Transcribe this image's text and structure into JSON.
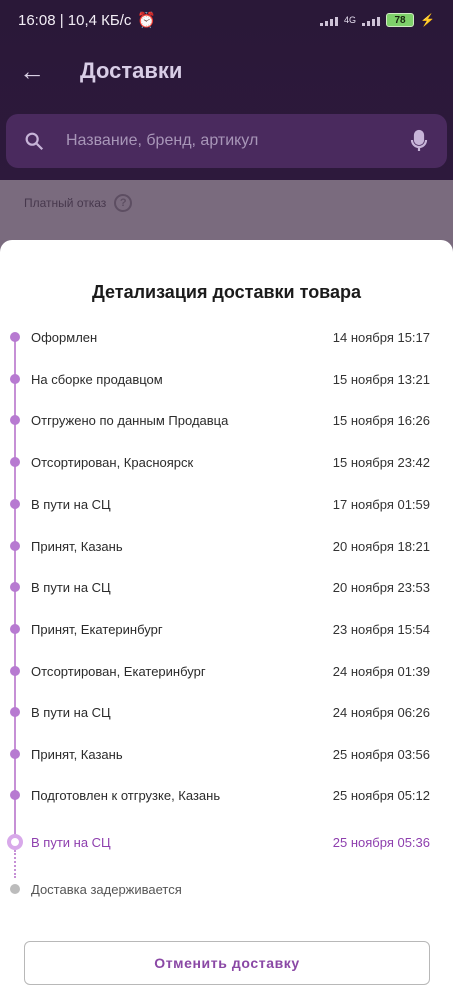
{
  "status_bar": {
    "time_info": "16:08 | 10,4 КБ/с",
    "network": "4G",
    "battery": "78"
  },
  "toolbar": {
    "title": "Доставки"
  },
  "search": {
    "placeholder": "Название, бренд, артикул"
  },
  "under_card": {
    "label": "Платный отказ"
  },
  "sheet": {
    "title": "Детализация доставки товара",
    "events": [
      {
        "label": "Оформлен",
        "time": "14 ноября 15:17"
      },
      {
        "label": "На сборке продавцом",
        "time": "15 ноября 13:21"
      },
      {
        "label": "Отгружено по данным Продавца",
        "time": "15 ноября 16:26"
      },
      {
        "label": "Отсортирован, Красноярск",
        "time": "15 ноября 23:42"
      },
      {
        "label": "В пути на СЦ",
        "time": "17 ноября 01:59"
      },
      {
        "label": "Принят, Казань",
        "time": "20 ноября 18:21"
      },
      {
        "label": "В пути на СЦ",
        "time": "20 ноября 23:53"
      },
      {
        "label": "Принят, Екатеринбург",
        "time": "23 ноября 15:54"
      },
      {
        "label": "Отсортирован, Екатеринбург",
        "time": "24 ноября 01:39"
      },
      {
        "label": "В пути на СЦ",
        "time": "24 ноября 06:26"
      },
      {
        "label": "Принят, Казань",
        "time": "25 ноября 03:56"
      },
      {
        "label": "Подготовлен к отгрузке, Казань",
        "time": "25 ноября 05:12"
      },
      {
        "label": "В пути на СЦ",
        "time": "25 ноября 05:36"
      },
      {
        "label": "Доставка задерживается",
        "time": ""
      }
    ],
    "cancel_label": "Отменить доставку"
  },
  "colors": {
    "accent": "#8e3fae",
    "timeline": "#c690d6"
  }
}
